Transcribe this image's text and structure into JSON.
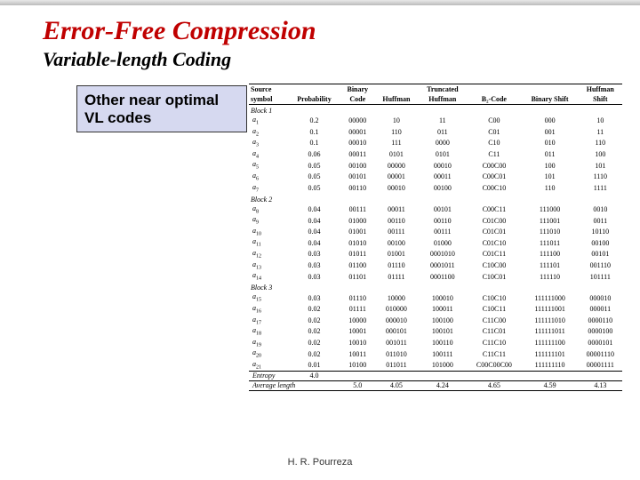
{
  "title": "Error-Free Compression",
  "subtitle": "Variable-length Coding",
  "callout": "Other near optimal VL codes",
  "footer": "H. R. Pourreza",
  "headers": [
    {
      "l1": "Source",
      "l2": "symbol"
    },
    {
      "l1": "",
      "l2": "Probability"
    },
    {
      "l1": "Binary",
      "l2": "Code"
    },
    {
      "l1": "",
      "l2": "Huffman"
    },
    {
      "l1": "Truncated",
      "l2": "Huffman"
    },
    {
      "l1": "",
      "l2": "B₂-Code"
    },
    {
      "l1": "",
      "l2": "Binary Shift"
    },
    {
      "l1": "Huffman",
      "l2": "Shift"
    }
  ],
  "blocks": [
    {
      "label": "Block 1",
      "rows": [
        {
          "s": "a",
          "i": "1",
          "p": "0.2",
          "b": "00000",
          "h": "10",
          "th": "11",
          "b2": "C00",
          "bs": "000",
          "hs": "10"
        },
        {
          "s": "a",
          "i": "2",
          "p": "0.1",
          "b": "00001",
          "h": "110",
          "th": "011",
          "b2": "C01",
          "bs": "001",
          "hs": "11"
        },
        {
          "s": "a",
          "i": "3",
          "p": "0.1",
          "b": "00010",
          "h": "111",
          "th": "0000",
          "b2": "C10",
          "bs": "010",
          "hs": "110"
        },
        {
          "s": "a",
          "i": "4",
          "p": "0.06",
          "b": "00011",
          "h": "0101",
          "th": "0101",
          "b2": "C11",
          "bs": "011",
          "hs": "100"
        },
        {
          "s": "a",
          "i": "5",
          "p": "0.05",
          "b": "00100",
          "h": "00000",
          "th": "00010",
          "b2": "C00C00",
          "bs": "100",
          "hs": "101"
        },
        {
          "s": "a",
          "i": "6",
          "p": "0.05",
          "b": "00101",
          "h": "00001",
          "th": "00011",
          "b2": "C00C01",
          "bs": "101",
          "hs": "1110"
        },
        {
          "s": "a",
          "i": "7",
          "p": "0.05",
          "b": "00110",
          "h": "00010",
          "th": "00100",
          "b2": "C00C10",
          "bs": "110",
          "hs": "1111"
        }
      ]
    },
    {
      "label": "Block 2",
      "rows": [
        {
          "s": "a",
          "i": "8",
          "p": "0.04",
          "b": "00111",
          "h": "00011",
          "th": "00101",
          "b2": "C00C11",
          "bs": "111000",
          "hs": "0010"
        },
        {
          "s": "a",
          "i": "9",
          "p": "0.04",
          "b": "01000",
          "h": "00110",
          "th": "00110",
          "b2": "C01C00",
          "bs": "111001",
          "hs": "0011"
        },
        {
          "s": "a",
          "i": "10",
          "p": "0.04",
          "b": "01001",
          "h": "00111",
          "th": "00111",
          "b2": "C01C01",
          "bs": "111010",
          "hs": "10110"
        },
        {
          "s": "a",
          "i": "11",
          "p": "0.04",
          "b": "01010",
          "h": "00100",
          "th": "01000",
          "b2": "C01C10",
          "bs": "111011",
          "hs": "00100"
        },
        {
          "s": "a",
          "i": "12",
          "p": "0.03",
          "b": "01011",
          "h": "01001",
          "th": "0001010",
          "b2": "C01C11",
          "bs": "111100",
          "hs": "00101"
        },
        {
          "s": "a",
          "i": "13",
          "p": "0.03",
          "b": "01100",
          "h": "01110",
          "th": "0001011",
          "b2": "C10C00",
          "bs": "111101",
          "hs": "001110"
        },
        {
          "s": "a",
          "i": "14",
          "p": "0.03",
          "b": "01101",
          "h": "01111",
          "th": "0001100",
          "b2": "C10C01",
          "bs": "111110",
          "hs": "101111"
        }
      ]
    },
    {
      "label": "Block 3",
      "rows": [
        {
          "s": "a",
          "i": "15",
          "p": "0.03",
          "b": "01110",
          "h": "10000",
          "th": "100010",
          "b2": "C10C10",
          "bs": "111111000",
          "hs": "000010"
        },
        {
          "s": "a",
          "i": "16",
          "p": "0.02",
          "b": "01111",
          "h": "010000",
          "th": "100011",
          "b2": "C10C11",
          "bs": "111111001",
          "hs": "000011"
        },
        {
          "s": "a",
          "i": "17",
          "p": "0.02",
          "b": "10000",
          "h": "000010",
          "th": "100100",
          "b2": "C11C00",
          "bs": "111111010",
          "hs": "0000110"
        },
        {
          "s": "a",
          "i": "18",
          "p": "0.02",
          "b": "10001",
          "h": "000101",
          "th": "100101",
          "b2": "C11C01",
          "bs": "111111011",
          "hs": "0000100"
        },
        {
          "s": "a",
          "i": "19",
          "p": "0.02",
          "b": "10010",
          "h": "001011",
          "th": "100110",
          "b2": "C11C10",
          "bs": "111111100",
          "hs": "0000101"
        },
        {
          "s": "a",
          "i": "20",
          "p": "0.02",
          "b": "10011",
          "h": "011010",
          "th": "100111",
          "b2": "C11C11",
          "bs": "111111101",
          "hs": "00001110"
        },
        {
          "s": "a",
          "i": "21",
          "p": "0.01",
          "b": "10100",
          "h": "011011",
          "th": "101000",
          "b2": "C00C00C00",
          "bs": "111111110",
          "hs": "00001111"
        }
      ]
    }
  ],
  "entropy": {
    "label": "Entropy",
    "val": "4.0"
  },
  "avg": {
    "label": "Average length",
    "vals": [
      "5.0",
      "4.05",
      "4.24",
      "4.65",
      "4.59",
      "4.13"
    ]
  }
}
